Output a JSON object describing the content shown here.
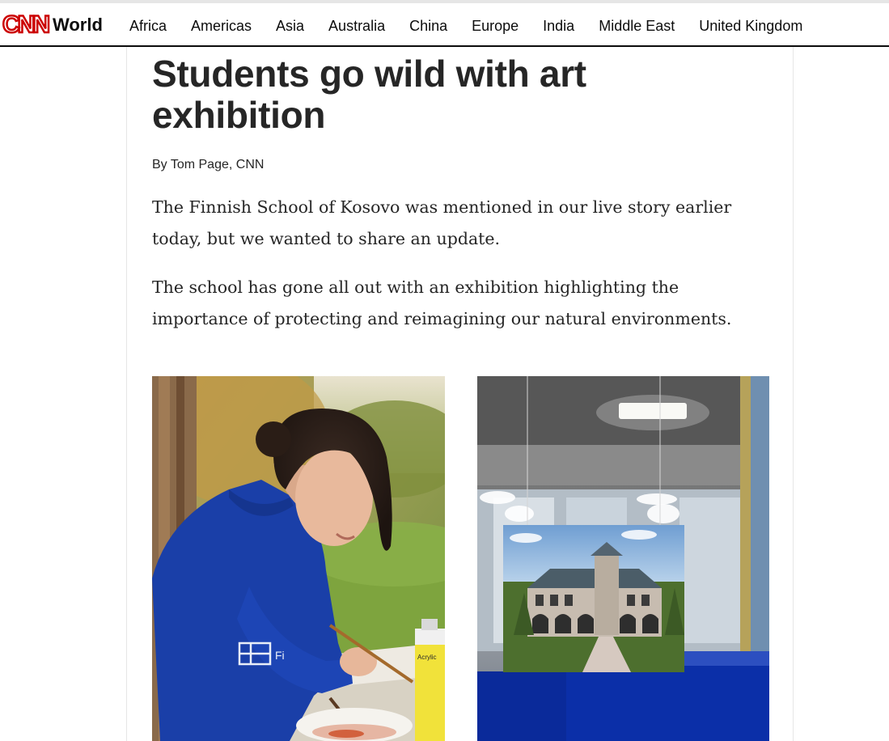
{
  "header": {
    "brand": "CNN",
    "section": "World",
    "nav": [
      "Africa",
      "Americas",
      "Asia",
      "Australia",
      "China",
      "Europe",
      "India",
      "Middle East",
      "United Kingdom"
    ]
  },
  "article": {
    "headline": "Students go wild with art exhibition",
    "byline": "By Tom Page, CNN",
    "paragraphs": [
      "The Finnish School of Kosovo was mentioned in our live story earlier today, but we wanted to share an update.",
      "The school has gone all out with an exhibition highlighting the importance of protecting and reimagining our natural environments."
    ],
    "photos": [
      {
        "subject": "student-painting-photo",
        "shirt_text": "Fi",
        "paint_label": "Acrylic"
      },
      {
        "subject": "building-painting-photo"
      }
    ]
  },
  "colors": {
    "brand_red": "#cc0000",
    "text": "#262626",
    "hoodie_blue": "#1a3fa8",
    "display_blue": "#0a2a9a"
  }
}
